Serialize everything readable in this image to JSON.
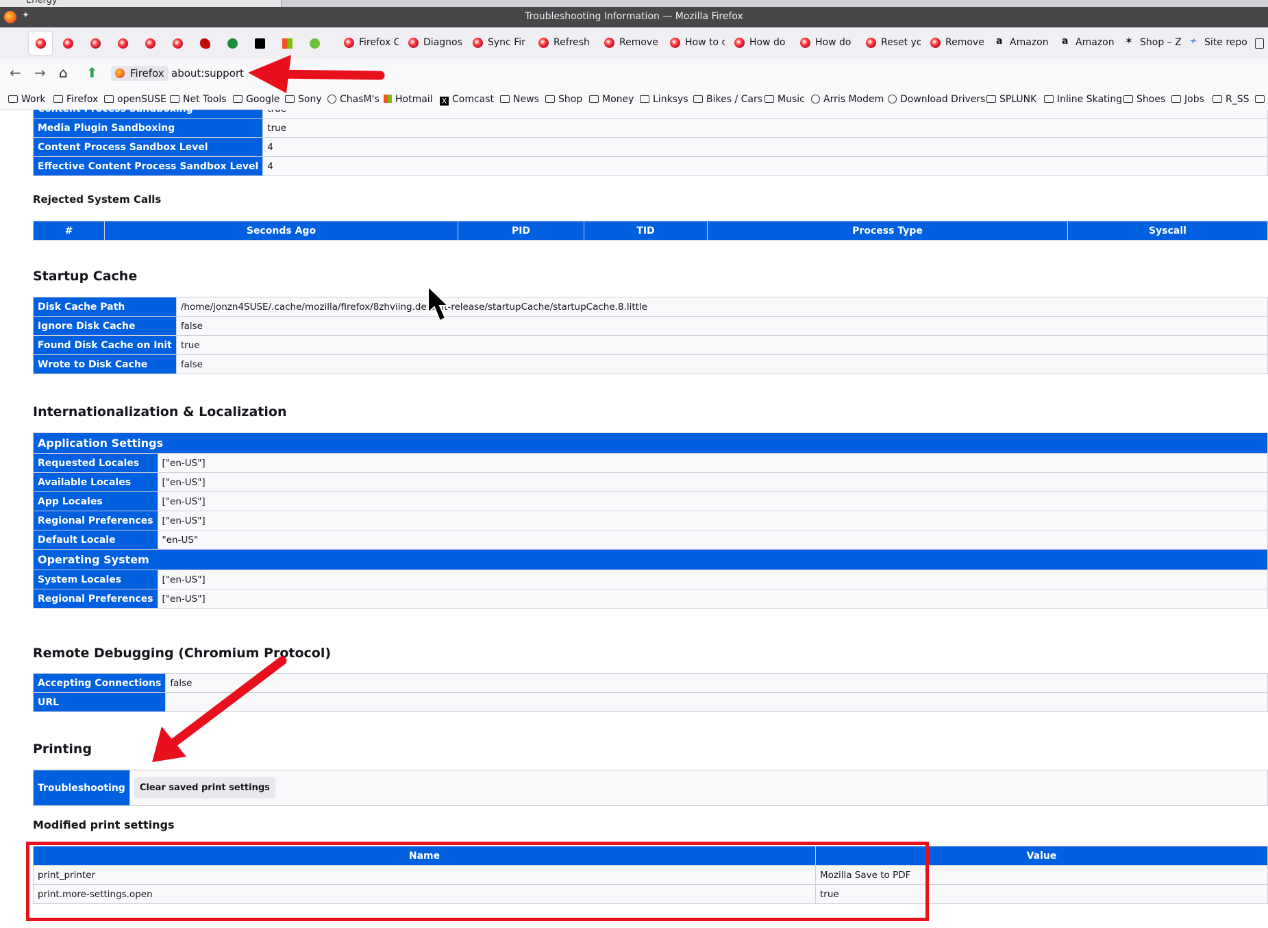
{
  "window": {
    "title": "Troubleshooting Information — Mozilla Firefox",
    "prev_tab": "Energy"
  },
  "tabs": [
    "Firefox C",
    "Diagnos",
    "Sync Fir",
    "Refresh",
    "Remove",
    "How to c",
    "How do",
    "How do",
    "Reset yo",
    "Remove",
    "Amazon",
    "Amazon",
    "Shop – Z",
    "Site repo"
  ],
  "urlbar": {
    "identity": "Firefox",
    "url": "about:support"
  },
  "bookmarks": [
    "Work",
    "Firefox",
    "openSUSE",
    "Net Tools",
    "Google",
    "Sony",
    "ChasM's",
    "Hotmail",
    "Comcast",
    "News",
    "Shop",
    "Money",
    "Linksys",
    "Bikes / Cars",
    "Music",
    "Arris Modem",
    "Download Drivers",
    "SPLUNK",
    "Inline Skating",
    "Shoes",
    "Jobs",
    "R_SS"
  ],
  "sandbox": {
    "rows": [
      {
        "k": "Content Process Sandboxing",
        "v": "true"
      },
      {
        "k": "Media Plugin Sandboxing",
        "v": "true"
      },
      {
        "k": "Content Process Sandbox Level",
        "v": "4"
      },
      {
        "k": "Effective Content Process Sandbox Level",
        "v": "4"
      }
    ]
  },
  "rejected": {
    "title": "Rejected System Calls",
    "cols": [
      "#",
      "Seconds Ago",
      "PID",
      "TID",
      "Process Type",
      "Syscall"
    ]
  },
  "startup": {
    "title": "Startup Cache",
    "rows": [
      {
        "k": "Disk Cache Path",
        "v": "/home/jonzn4SUSE/.cache/mozilla/firefox/8zhviing.default-release/startupCache/startupCache.8.little"
      },
      {
        "k": "Ignore Disk Cache",
        "v": "false"
      },
      {
        "k": "Found Disk Cache on Init",
        "v": "true"
      },
      {
        "k": "Wrote to Disk Cache",
        "v": "false"
      }
    ]
  },
  "intl": {
    "title": "Internationalization & Localization",
    "app_title": "Application Settings",
    "app_rows": [
      {
        "k": "Requested Locales",
        "v": "[\"en-US\"]"
      },
      {
        "k": "Available Locales",
        "v": "[\"en-US\"]"
      },
      {
        "k": "App Locales",
        "v": "[\"en-US\"]"
      },
      {
        "k": "Regional Preferences",
        "v": "[\"en-US\"]"
      },
      {
        "k": "Default Locale",
        "v": "\"en-US\""
      }
    ],
    "os_title": "Operating System",
    "os_rows": [
      {
        "k": "System Locales",
        "v": "[\"en-US\"]"
      },
      {
        "k": "Regional Preferences",
        "v": "[\"en-US\"]"
      }
    ]
  },
  "remote": {
    "title": "Remote Debugging (Chromium Protocol)",
    "rows": [
      {
        "k": "Accepting Connections",
        "v": "false"
      },
      {
        "k": "URL",
        "v": ""
      }
    ]
  },
  "printing": {
    "title": "Printing",
    "row_label": "Troubleshooting",
    "button": "Clear saved print settings",
    "modified_title": "Modified print settings",
    "cols": [
      "Name",
      "Value"
    ],
    "rows": [
      {
        "name": "print_printer",
        "value": "Mozilla Save to PDF"
      },
      {
        "name": "print.more-settings.open",
        "value": "true"
      }
    ]
  },
  "colors": {
    "header_blue": "#0060df",
    "annotation_red": "#e8101d"
  }
}
